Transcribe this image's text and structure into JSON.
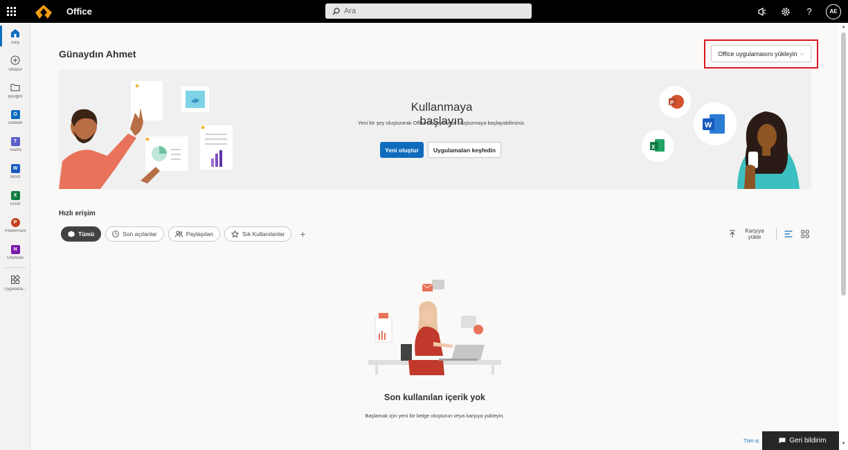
{
  "topbar": {
    "app_name": "Office",
    "search_placeholder": "Ara",
    "avatar_initials": "AE",
    "help_label": "?"
  },
  "rail": {
    "items": [
      {
        "label": "Giriş",
        "icon": "home-icon"
      },
      {
        "label": "Oluştur",
        "icon": "plus-circle-icon"
      },
      {
        "label": "İçeriğim",
        "icon": "folder-icon"
      },
      {
        "label": "Outlook",
        "icon": "outlook-icon",
        "letter": "O",
        "color": "#0f6cbd"
      },
      {
        "label": "Teams",
        "icon": "teams-icon",
        "letter": "T",
        "color": "#5b5fc7"
      },
      {
        "label": "Word",
        "icon": "word-icon",
        "letter": "W",
        "color": "#185abd"
      },
      {
        "label": "Excel",
        "icon": "excel-icon",
        "letter": "X",
        "color": "#107c41"
      },
      {
        "label": "PowerPoint",
        "icon": "powerpoint-icon",
        "letter": "P",
        "color": "#c43e1c"
      },
      {
        "label": "OneNote",
        "icon": "onenote-icon",
        "letter": "N",
        "color": "#7719aa"
      },
      {
        "label": "Uygulama...",
        "icon": "apps-icon"
      }
    ]
  },
  "main": {
    "greeting": "Günaydın Ahmet",
    "install_label": "Office uygulamasını yükleyin",
    "hero": {
      "title": "Kullanmaya başlayın",
      "subtitle": "Yeni bir şey oluşturarak Office deneyiminizi oluşturmaya başlayabilirsiniz.",
      "primary_label": "Yeni oluştur",
      "secondary_label": "Uygulamaları keşfedin"
    },
    "quick_access": {
      "title": "Hızlı erişim",
      "filters": [
        {
          "label": "Tümü",
          "active": true
        },
        {
          "label": "Son açılanlar",
          "active": false
        },
        {
          "label": "Paylaşılan",
          "active": false
        },
        {
          "label": "Sık Kullanılanlar",
          "active": false
        }
      ],
      "upload_label_1": "Karşıya",
      "upload_label_2": "yükle"
    },
    "empty": {
      "title": "Son kullanılan içerik yok",
      "subtitle": "Başlamak için yeni bir belge oluşturun veya karşıya yükleyin."
    },
    "all_link": "Tüm iç",
    "feedback_label": "Geri bildirim"
  },
  "colors": {
    "accent": "#0f6cbd",
    "highlight": "#d8141f"
  }
}
